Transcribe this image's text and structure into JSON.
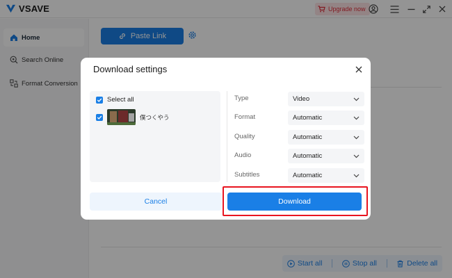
{
  "app": {
    "name": "VSAVE",
    "upgrade_label": "Upgrade now"
  },
  "sidebar": {
    "items": [
      {
        "label": "Home",
        "icon": "home-icon",
        "active": true
      },
      {
        "label": "Search Online",
        "icon": "search-icon",
        "active": false
      },
      {
        "label": "Format Conversion",
        "icon": "convert-icon",
        "active": false
      }
    ]
  },
  "main": {
    "paste_label": "Paste Link",
    "actions": {
      "start_all": "Start all",
      "stop_all": "Stop all",
      "delete_all": "Delete all"
    }
  },
  "dialog": {
    "title": "Download settings",
    "select_all_label": "Select all",
    "item_title": "僕つくやう",
    "options": [
      {
        "label": "Type",
        "value": "Video"
      },
      {
        "label": "Format",
        "value": "Automatic"
      },
      {
        "label": "Quality",
        "value": "Automatic"
      },
      {
        "label": "Audio",
        "value": "Automatic"
      },
      {
        "label": "Subtitles",
        "value": "Automatic"
      }
    ],
    "cancel_label": "Cancel",
    "download_label": "Download"
  },
  "colors": {
    "accent": "#1a7fe6",
    "highlight": "#e8141f",
    "upgrade": "#e0303c"
  }
}
